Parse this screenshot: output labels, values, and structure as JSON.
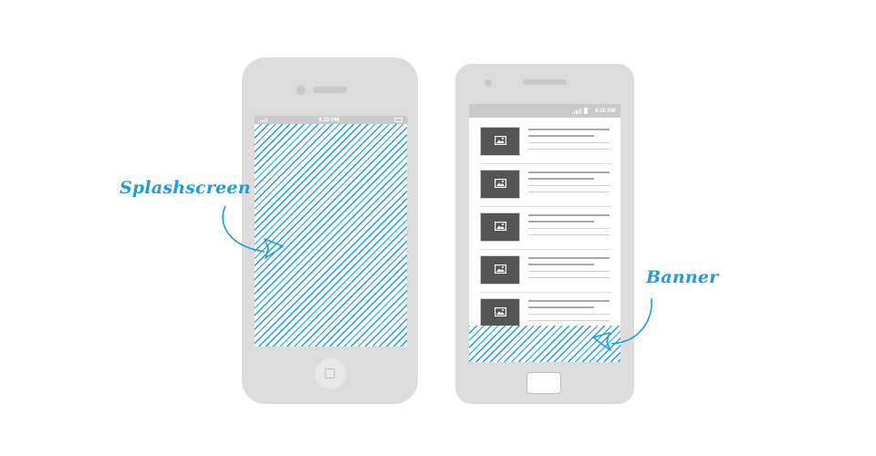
{
  "colors": {
    "accent": "#1aa0d8",
    "device": "#dcdcdc",
    "statusbar": "#c9c9c9",
    "thumb": "#555555"
  },
  "iphone": {
    "status": {
      "time": "4:20 PM"
    },
    "screen_icon": "diagonal-hatch-pattern",
    "home_icon": "home-square-icon"
  },
  "android": {
    "status": {
      "time": "4:20 PM"
    },
    "list_item_count": 5,
    "thumb_icon": "image-placeholder-icon",
    "banner_icon": "diagonal-hatch-pattern"
  },
  "annotations": {
    "splash_label": "Splashscreen",
    "banner_label": "Banner"
  }
}
